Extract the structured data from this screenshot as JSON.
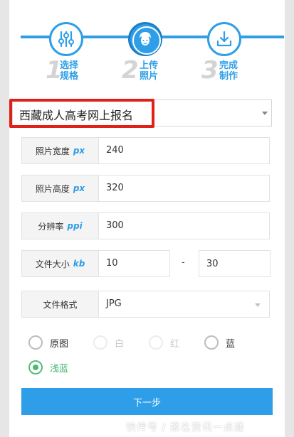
{
  "steps": [
    {
      "num": "1",
      "line1": "选择",
      "line2": "规格",
      "icon": "sliders-icon"
    },
    {
      "num": "2",
      "line1": "上传",
      "line2": "照片",
      "icon": "person-icon"
    },
    {
      "num": "3",
      "line1": "完成",
      "line2": "制作",
      "icon": "download-icon"
    }
  ],
  "spec_select": {
    "value": "西藏成人高考网上报名"
  },
  "fields": {
    "width": {
      "label": "照片宽度",
      "unit": "px",
      "value": "240"
    },
    "height": {
      "label": "照片高度",
      "unit": "px",
      "value": "320"
    },
    "resolution": {
      "label": "分辨率",
      "unit": "ppi",
      "value": "300"
    },
    "filesize": {
      "label": "文件大小",
      "unit": "kb",
      "min": "10",
      "separator": "-",
      "max": "30"
    },
    "format": {
      "label": "文件格式",
      "value": "JPG"
    }
  },
  "background_options": [
    {
      "label": "原图",
      "state": "enabled"
    },
    {
      "label": "白",
      "state": "disabled"
    },
    {
      "label": "红",
      "state": "disabled"
    },
    {
      "label": "蓝",
      "state": "enabled"
    },
    {
      "label": "浅蓝",
      "state": "checked"
    }
  ],
  "next_button": "下一步",
  "watermark": "快传号 / 报名资讯一点通",
  "colors": {
    "accent": "#2e9ee8",
    "highlight": "#e0211a",
    "checked": "#4cb870"
  }
}
